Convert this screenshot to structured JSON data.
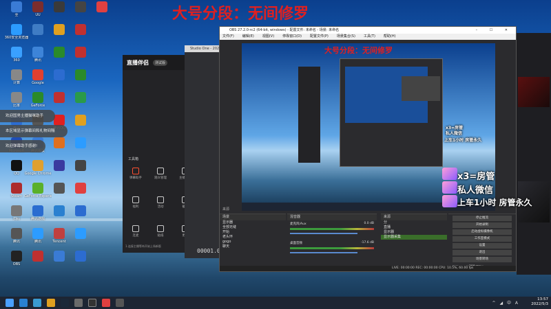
{
  "overlay_title": "大号分段：无间修罗",
  "overlay_title_small": "大号分段：无间修罗",
  "toasts": [
    "欢迎国男主播猫咪助手",
    "本区域显示弹幕间和礼物间隔",
    "欢迎弹幕助手感谢!"
  ],
  "desktop_icons": [
    {
      "label": "全",
      "color": "#3a7bd5"
    },
    {
      "label": "360安全浏览器",
      "color": "#2c9cff"
    },
    {
      "label": "360",
      "color": "#3aa0ff"
    },
    {
      "label": "计算",
      "color": "#888"
    },
    {
      "label": "比率",
      "color": "#888"
    },
    {
      "label": "腾讯",
      "color": "#2c6cd0"
    },
    {
      "label": "Microsoft",
      "color": "#1e4db7"
    },
    {
      "label": "QQ",
      "color": "#111"
    },
    {
      "label": "Steam",
      "color": "#ad2c2c"
    },
    {
      "label": "扫码",
      "color": "#777"
    },
    {
      "label": "腾讯",
      "color": "#555"
    },
    {
      "label": "OBS",
      "color": "#222"
    },
    {
      "label": "UU",
      "color": "#7b2d2d"
    },
    {
      "label": "",
      "color": "#3f7cc4"
    },
    {
      "label": "腾讯",
      "color": "#3d84d8"
    },
    {
      "label": "Google",
      "color": "#e04030"
    },
    {
      "label": "GeForce",
      "color": "#2a8a2a"
    },
    {
      "label": "",
      "color": "#555"
    },
    {
      "label": "腾讯会议",
      "color": "#3a7bd5"
    },
    {
      "label": "Google Chrome",
      "color": "#e0a030"
    },
    {
      "label": "GeForce Experience",
      "color": "#5ab02a"
    },
    {
      "label": "腾讯游戏",
      "color": "#2a6dd0"
    },
    {
      "label": "腾讯",
      "color": "#2c9cff"
    },
    {
      "label": "",
      "color": "#c03030"
    },
    {
      "label": "",
      "color": "#3a3a3a"
    },
    {
      "label": "",
      "color": "#e0a020"
    },
    {
      "label": "",
      "color": "#2a8a2a"
    },
    {
      "label": "",
      "color": "#2c6cd0"
    },
    {
      "label": "",
      "color": "#c03030"
    },
    {
      "label": "腾讯QQ",
      "color": "#e02020"
    },
    {
      "label": "",
      "color": "#e07020"
    },
    {
      "label": "",
      "color": "#3a3aa0"
    },
    {
      "label": "",
      "color": "#555"
    },
    {
      "label": "",
      "color": "#2a80d0"
    },
    {
      "label": "Tencent",
      "color": "#c04040"
    },
    {
      "label": "",
      "color": "#3a7bd5"
    },
    {
      "label": "",
      "color": "#444"
    },
    {
      "label": "",
      "color": "#c03030"
    },
    {
      "label": "",
      "color": "#c03030"
    },
    {
      "label": "",
      "color": "#2a8a2a"
    },
    {
      "label": "",
      "color": "#2a9a4a"
    },
    {
      "label": "",
      "color": "#e0a020"
    },
    {
      "label": "",
      "color": "#2c9cff"
    },
    {
      "label": "",
      "color": "#444"
    },
    {
      "label": "",
      "color": "#e04040"
    },
    {
      "label": "",
      "color": "#2c6cd0"
    },
    {
      "label": "",
      "color": "#2c9cff"
    },
    {
      "label": "",
      "color": "#2c6cd0"
    },
    {
      "label": "",
      "color": "#e04040"
    }
  ],
  "live_companion": {
    "logo": "直播伴侣",
    "version": "测试版",
    "tools_title": "工具箱",
    "tabs": [
      "",
      ""
    ],
    "tools": [
      {
        "label": "弹幕助手"
      },
      {
        "label": "观众管理"
      },
      {
        "label": "主播任务"
      },
      {
        "label": "福利"
      },
      {
        "label": "活动"
      },
      {
        "label": "截图"
      },
      {
        "label": "连麦"
      },
      {
        "label": "贴纸"
      },
      {
        "label": "更多"
      }
    ],
    "footer": "1.连接主播等待开始上场新版"
  },
  "studio": {
    "title": "Studio One - 2022",
    "time": "00001.01"
  },
  "obs": {
    "title": "OBS 27.2.0-rc2 (64-bit, windows) - 配置文件: 未命名 - 场景: 未命名",
    "menu": [
      "文件(F)",
      "编辑(E)",
      "视图(V)",
      "停靠窗口(D)",
      "配置文件(P)",
      "场景集合(S)",
      "工具(T)",
      "帮助(H)"
    ],
    "panel_labels": [
      "来源",
      "场景",
      "混音器",
      "来源",
      "控制"
    ],
    "scenes": [
      "显示器",
      "全部无缝",
      "开始",
      "老头环",
      "gogo",
      "聊天"
    ],
    "sources": [
      "分",
      "直播",
      "显示器",
      "显示器采集"
    ],
    "mixer": [
      {
        "name": "麦克风/Aux",
        "db": "0.0 dB"
      },
      {
        "name": "桌面音频",
        "db": "-17.6 dB"
      }
    ],
    "controls": [
      "停止推流",
      "开始录制",
      "启动虚拟摄像机",
      "工作室模式",
      "设置",
      "退出",
      "场景转场"
    ],
    "transition": "渐变",
    "duration_label": "时长",
    "duration": "300 ms",
    "status": "LIVE: 00:00:00   REC: 00:00:00   CPU: 10.5%, 60.00 fps",
    "top_badge": "13:57"
  },
  "overlay": {
    "line1": "x3=房管",
    "line2": "私人微信",
    "line3": "上车1小时  房管永久"
  },
  "small_overlay": {
    "line1": "x3=房管",
    "line2": "私人微信",
    "line3": "上车1小时 房管永久"
  },
  "taskbar": {
    "time": "13:57",
    "date": "2022/5/3",
    "tray": "^ ◢ 中 A"
  }
}
